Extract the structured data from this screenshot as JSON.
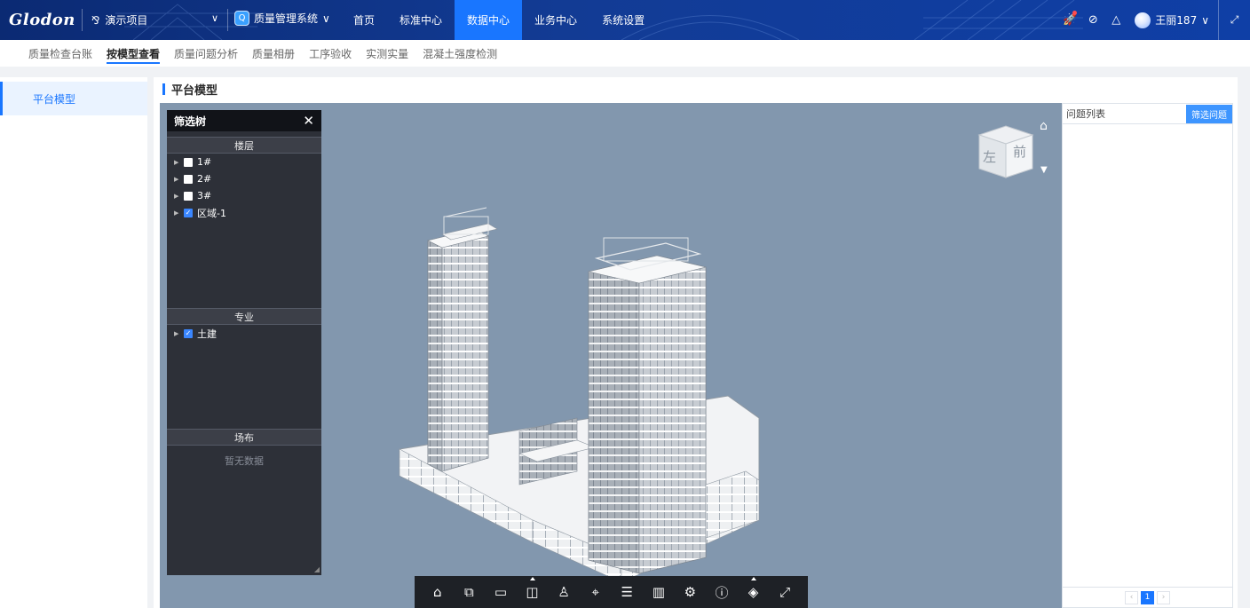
{
  "topbar": {
    "logo": "Glodon",
    "project_name": "演示项目",
    "system_name": "质量管理系统",
    "nav": [
      {
        "label": "首页",
        "active": false
      },
      {
        "label": "标准中心",
        "active": false
      },
      {
        "label": "数据中心",
        "active": true
      },
      {
        "label": "业务中心",
        "active": false
      },
      {
        "label": "系统设置",
        "active": false
      }
    ],
    "user_name": "王丽187"
  },
  "subtabs": [
    {
      "label": "质量检查台账",
      "active": false
    },
    {
      "label": "按模型查看",
      "active": true
    },
    {
      "label": "质量问题分析",
      "active": false
    },
    {
      "label": "质量相册",
      "active": false
    },
    {
      "label": "工序验收",
      "active": false
    },
    {
      "label": "实测实量",
      "active": false
    },
    {
      "label": "混凝土强度检测",
      "active": false
    }
  ],
  "sidemenu": [
    {
      "label": "平台模型",
      "active": true
    }
  ],
  "content": {
    "title": "平台模型"
  },
  "filter_tree": {
    "title": "筛选树",
    "floor_section": "楼层",
    "floors": [
      {
        "label": "1#",
        "checked": false
      },
      {
        "label": "2#",
        "checked": false
      },
      {
        "label": "3#",
        "checked": false
      },
      {
        "label": "区域-1",
        "checked": true
      }
    ],
    "discipline_section": "专业",
    "disciplines": [
      {
        "label": "土建",
        "checked": true
      }
    ],
    "site_section": "场布",
    "site_empty": "暂无数据"
  },
  "navcube": {
    "left_face": "左",
    "front_face": "前"
  },
  "issues": {
    "title": "问题列表",
    "filter_button": "筛选问题",
    "current_page": "1"
  },
  "colors": {
    "accent": "#1976ff",
    "topbar": "#123b94",
    "viewer_bg": "#8297ae"
  }
}
